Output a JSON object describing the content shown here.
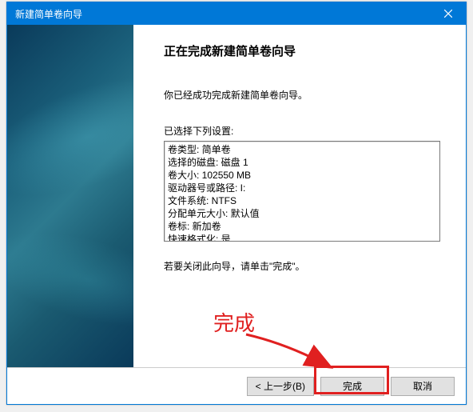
{
  "titlebar": {
    "title": "新建简单卷向导"
  },
  "main": {
    "heading": "正在完成新建简单卷向导",
    "intro": "你已经成功完成新建简单卷向导。",
    "settings_label": "已选择下列设置:",
    "settings_lines": [
      "卷类型: 简单卷",
      "选择的磁盘: 磁盘 1",
      "卷大小: 102550 MB",
      "驱动器号或路径: I:",
      "文件系统: NTFS",
      "分配单元大小: 默认值",
      "卷标: 新加卷",
      "快速格式化: 是"
    ],
    "closing": "若要关闭此向导，请单击\"完成\"。"
  },
  "footer": {
    "back": "< 上一步(B)",
    "finish": "完成",
    "cancel": "取消"
  },
  "annotation": {
    "text": "完成"
  }
}
